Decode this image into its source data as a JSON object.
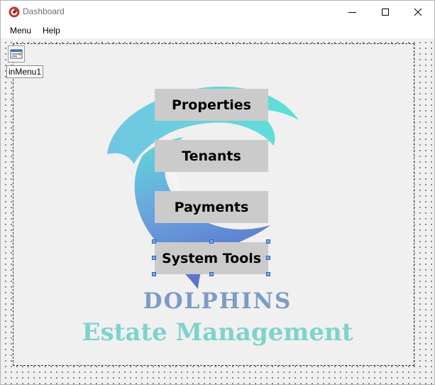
{
  "window": {
    "title": "Dashboard"
  },
  "menubar": {
    "items": [
      {
        "label": "Menu"
      },
      {
        "label": "Help"
      }
    ]
  },
  "designer": {
    "component_label": "inMenu1"
  },
  "buttons": [
    {
      "label": "Properties"
    },
    {
      "label": "Tenants"
    },
    {
      "label": "Payments"
    },
    {
      "label": "System Tools",
      "selected": true
    }
  ],
  "brand": {
    "title": "DOLPHINS",
    "subtitle": "Estate Management",
    "title_color": "#7d9bc6",
    "subtitle_color": "#7ed3cc"
  },
  "colors": {
    "button_bg": "#cbcbcb",
    "selection_handle": "#7ea8e0",
    "logo_teal": "#5ed6d8",
    "logo_blue": "#5b7fd0"
  },
  "icons": {
    "app": "app-logo-icon",
    "minimize": "minimize-icon",
    "maximize": "maximize-icon",
    "close": "close-icon",
    "menu_component": "main-menu-component-icon"
  }
}
